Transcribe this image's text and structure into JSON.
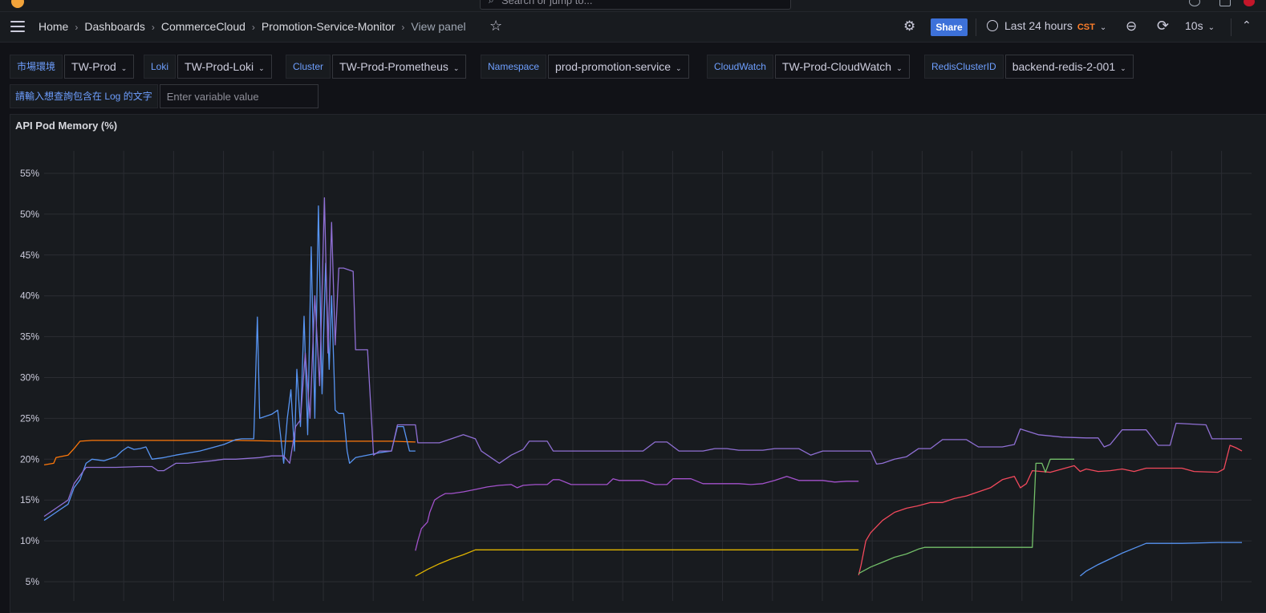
{
  "search": {
    "placeholder": "Search or jump to..."
  },
  "breadcrumbs": [
    "Home",
    "Dashboards",
    "CommerceCloud",
    "Promotion-Service-Monitor",
    "View panel"
  ],
  "toolbar": {
    "share_label": "Share",
    "time_range": "Last 24 hours",
    "timezone": "CST",
    "refresh_interval": "10s"
  },
  "variables": [
    {
      "label": "市場環境",
      "value": "TW-Prod"
    },
    {
      "label": "Loki",
      "value": "TW-Prod-Loki"
    },
    {
      "label": "Cluster",
      "value": "TW-Prod-Prometheus"
    },
    {
      "label": "Namespace",
      "value": "prod-promotion-service"
    },
    {
      "label": "CloudWatch",
      "value": "TW-Prod-CloudWatch"
    },
    {
      "label": "RedisClusterID",
      "value": "backend-redis-2-001"
    }
  ],
  "text_variable": {
    "label": "請輸入想查詢包含在 Log 的文字",
    "placeholder": "Enter variable value"
  },
  "panel": {
    "title": "API Pod Memory (%)"
  },
  "chart_data": {
    "type": "line",
    "title": "API Pod Memory (%)",
    "ylim": [
      3,
      57
    ],
    "yticks": [
      "5%",
      "10%",
      "15%",
      "20%",
      "25%",
      "30%",
      "35%",
      "40%",
      "45%",
      "50%",
      "55%"
    ],
    "ytick_values": [
      5,
      10,
      15,
      20,
      25,
      30,
      35,
      40,
      45,
      50,
      55
    ],
    "xlim": [
      0,
      100
    ],
    "grid": true,
    "series": [
      {
        "color": "#ff780a",
        "points": [
          [
            0,
            19.3
          ],
          [
            0.8,
            19.5
          ],
          [
            1,
            20.2
          ],
          [
            2,
            20.5
          ],
          [
            2.5,
            21.3
          ],
          [
            3,
            22.2
          ],
          [
            4,
            22.3
          ],
          [
            10,
            22.3
          ],
          [
            16,
            22.3
          ],
          [
            20,
            22.2
          ],
          [
            29,
            22.2
          ],
          [
            31,
            22.1
          ]
        ]
      },
      {
        "color": "#5794f2",
        "points": [
          [
            0,
            12.5
          ],
          [
            1,
            13.5
          ],
          [
            2,
            14.5
          ],
          [
            2.5,
            16.5
          ],
          [
            3,
            17.5
          ],
          [
            3.5,
            19.5
          ],
          [
            4,
            20
          ],
          [
            5,
            19.8
          ],
          [
            6,
            20.3
          ],
          [
            6.5,
            21
          ],
          [
            7,
            21.5
          ],
          [
            7.5,
            21.2
          ],
          [
            8,
            21.3
          ],
          [
            8.5,
            21.5
          ],
          [
            9,
            20
          ],
          [
            10,
            20.2
          ],
          [
            11,
            20.5
          ],
          [
            13,
            21
          ],
          [
            15,
            21.8
          ],
          [
            16,
            22.4
          ],
          [
            16.5,
            22.5
          ],
          [
            17.5,
            22.5
          ],
          [
            17.8,
            37.4
          ],
          [
            18,
            25
          ],
          [
            19,
            25.5
          ],
          [
            19.5,
            26
          ],
          [
            20,
            19.5
          ],
          [
            20.3,
            25
          ],
          [
            20.6,
            28.5
          ],
          [
            20.9,
            21
          ],
          [
            21.1,
            31
          ],
          [
            21.4,
            24
          ],
          [
            21.7,
            37.5
          ],
          [
            22,
            23
          ],
          [
            22.3,
            46
          ],
          [
            22.6,
            25
          ],
          [
            22.9,
            51
          ],
          [
            23.2,
            28
          ],
          [
            23.5,
            44
          ],
          [
            23.8,
            31
          ],
          [
            24,
            40
          ],
          [
            24.3,
            26
          ],
          [
            24.6,
            25.6
          ],
          [
            25,
            25.6
          ],
          [
            25.3,
            21
          ],
          [
            25.5,
            19.5
          ],
          [
            26,
            20.2
          ],
          [
            27,
            20.5
          ],
          [
            28,
            20.8
          ],
          [
            29,
            21
          ],
          [
            29.5,
            24
          ],
          [
            30,
            24
          ],
          [
            30.5,
            21
          ],
          [
            31,
            21
          ]
        ]
      },
      {
        "color": "#8f6fd4",
        "points": [
          [
            0,
            13
          ],
          [
            1,
            14
          ],
          [
            2,
            15
          ],
          [
            2.5,
            17
          ],
          [
            3,
            18
          ],
          [
            3.5,
            19
          ],
          [
            4,
            19
          ],
          [
            6,
            19
          ],
          [
            8,
            19.1
          ],
          [
            9,
            19.1
          ],
          [
            9.5,
            18.6
          ],
          [
            10,
            18.6
          ],
          [
            11,
            19.5
          ],
          [
            12,
            19.5
          ],
          [
            14,
            19.8
          ],
          [
            15,
            20
          ],
          [
            16,
            20
          ],
          [
            17,
            20.1
          ],
          [
            18,
            20.2
          ],
          [
            19,
            20.4
          ],
          [
            20,
            20.4
          ],
          [
            20.5,
            19.5
          ],
          [
            21,
            24
          ],
          [
            21.4,
            24.8
          ],
          [
            21.8,
            33
          ],
          [
            22.2,
            25
          ],
          [
            22.6,
            40
          ],
          [
            23,
            29
          ],
          [
            23.4,
            52
          ],
          [
            23.7,
            33
          ],
          [
            24,
            49
          ],
          [
            24.3,
            34
          ],
          [
            24.6,
            43.4
          ],
          [
            25,
            43.4
          ],
          [
            25.8,
            43
          ],
          [
            26,
            33.4
          ],
          [
            27,
            33.4
          ],
          [
            27.5,
            20.5
          ],
          [
            28,
            21
          ],
          [
            29,
            21
          ],
          [
            29.5,
            24.2
          ],
          [
            31,
            24.2
          ],
          [
            31.2,
            22
          ],
          [
            33,
            22
          ],
          [
            34,
            22.5
          ],
          [
            35,
            23
          ],
          [
            36,
            22.5
          ],
          [
            36.5,
            21
          ],
          [
            37,
            20.5
          ],
          [
            38,
            19.5
          ],
          [
            39,
            20.5
          ],
          [
            40,
            21.2
          ],
          [
            40.5,
            22.2
          ],
          [
            42,
            22.2
          ],
          [
            42.5,
            21
          ],
          [
            45,
            21
          ],
          [
            50,
            21
          ],
          [
            51,
            22.1
          ],
          [
            52,
            22.1
          ],
          [
            53,
            21
          ],
          [
            55,
            21
          ],
          [
            56,
            21.3
          ],
          [
            57,
            21.3
          ],
          [
            58,
            21.1
          ],
          [
            60,
            21.1
          ],
          [
            61,
            21.3
          ],
          [
            63,
            21.3
          ],
          [
            64,
            20.5
          ],
          [
            65,
            21
          ],
          [
            66,
            21
          ],
          [
            68,
            21
          ],
          [
            69,
            21
          ],
          [
            69.5,
            19.4
          ],
          [
            70,
            19.5
          ],
          [
            71,
            20
          ],
          [
            72,
            20.3
          ],
          [
            73,
            21.3
          ],
          [
            74,
            21.3
          ],
          [
            75,
            22.4
          ],
          [
            77,
            22.4
          ],
          [
            78,
            21.5
          ],
          [
            79,
            21.5
          ],
          [
            80,
            21.5
          ],
          [
            81,
            21.8
          ],
          [
            81.5,
            23.7
          ],
          [
            83,
            23
          ],
          [
            85,
            22.7
          ],
          [
            87,
            22.6
          ],
          [
            88,
            22.6
          ],
          [
            88.5,
            21.5
          ],
          [
            89,
            21.8
          ],
          [
            90,
            23.6
          ],
          [
            92,
            23.6
          ],
          [
            93,
            21.7
          ],
          [
            94,
            21.7
          ],
          [
            94.5,
            24.4
          ],
          [
            97,
            24.2
          ],
          [
            97.5,
            22.5
          ],
          [
            100,
            22.5
          ]
        ]
      },
      {
        "color": "#a352cc",
        "points": [
          [
            31,
            8.8
          ],
          [
            31.2,
            10
          ],
          [
            31.5,
            11.5
          ],
          [
            32,
            12.3
          ],
          [
            32.2,
            13.5
          ],
          [
            32.6,
            15
          ],
          [
            33,
            15.4
          ],
          [
            33.5,
            15.8
          ],
          [
            34,
            15.8
          ],
          [
            35,
            16
          ],
          [
            36,
            16.3
          ],
          [
            37,
            16.6
          ],
          [
            38,
            16.8
          ],
          [
            39,
            16.9
          ],
          [
            39.5,
            16.5
          ],
          [
            40,
            16.8
          ],
          [
            41,
            16.9
          ],
          [
            42,
            16.9
          ],
          [
            42.5,
            17.5
          ],
          [
            43,
            17.5
          ],
          [
            44,
            16.9
          ],
          [
            47,
            16.9
          ],
          [
            47.5,
            17.6
          ],
          [
            48,
            17.4
          ],
          [
            50,
            17.4
          ],
          [
            51,
            16.9
          ],
          [
            52,
            16.9
          ],
          [
            52.5,
            17.6
          ],
          [
            54,
            17.6
          ],
          [
            55,
            17
          ],
          [
            57,
            17
          ],
          [
            58,
            17
          ],
          [
            59,
            16.9
          ],
          [
            60,
            17
          ],
          [
            61,
            17.4
          ],
          [
            62,
            17.9
          ],
          [
            63,
            17.4
          ],
          [
            65,
            17.4
          ],
          [
            66,
            17.2
          ],
          [
            67,
            17.3
          ],
          [
            68,
            17.3
          ]
        ]
      },
      {
        "color": "#e0b400",
        "points": [
          [
            31,
            5.7
          ],
          [
            32,
            6.5
          ],
          [
            33,
            7.2
          ],
          [
            34,
            7.8
          ],
          [
            35,
            8.3
          ],
          [
            36,
            8.9
          ],
          [
            40,
            8.9
          ],
          [
            50,
            8.9
          ],
          [
            60,
            8.9
          ],
          [
            65,
            8.9
          ],
          [
            68,
            8.9
          ]
        ]
      },
      {
        "color": "#f2495c",
        "points": [
          [
            68,
            5.8
          ],
          [
            68.2,
            7
          ],
          [
            68.4,
            8.5
          ],
          [
            68.6,
            10
          ],
          [
            69,
            11
          ],
          [
            70,
            12.5
          ],
          [
            71,
            13.5
          ],
          [
            72,
            14
          ],
          [
            73,
            14.3
          ],
          [
            74,
            14.7
          ],
          [
            75,
            14.7
          ],
          [
            76,
            15.2
          ],
          [
            77,
            15.5
          ],
          [
            78,
            16
          ],
          [
            79,
            16.5
          ],
          [
            80,
            17.5
          ],
          [
            81,
            17.9
          ],
          [
            81.5,
            16.5
          ],
          [
            82,
            17
          ],
          [
            82.5,
            18.6
          ],
          [
            84,
            18.4
          ],
          [
            85,
            18.8
          ],
          [
            86,
            19.2
          ],
          [
            86.5,
            18.5
          ],
          [
            87,
            18.8
          ],
          [
            88,
            18.5
          ],
          [
            89,
            18.6
          ],
          [
            90,
            18.8
          ],
          [
            91,
            18.5
          ],
          [
            92,
            18.9
          ],
          [
            95,
            18.9
          ],
          [
            96,
            18.5
          ],
          [
            98,
            18.4
          ],
          [
            98.5,
            18.8
          ],
          [
            99,
            21.7
          ],
          [
            99.5,
            21.4
          ],
          [
            100,
            21
          ]
        ]
      },
      {
        "color": "#73bf69",
        "points": [
          [
            68,
            6
          ],
          [
            69,
            6.8
          ],
          [
            70,
            7.4
          ],
          [
            71,
            8
          ],
          [
            72,
            8.4
          ],
          [
            73,
            9
          ],
          [
            73.5,
            9.2
          ],
          [
            76,
            9.2
          ],
          [
            79,
            9.2
          ],
          [
            82,
            9.2
          ],
          [
            82.5,
            9.2
          ],
          [
            82.8,
            19.5
          ],
          [
            83.3,
            19.5
          ],
          [
            83.6,
            18.4
          ],
          [
            84,
            20
          ],
          [
            86,
            20
          ]
        ]
      },
      {
        "color": "#5794f2",
        "points": [
          [
            86.5,
            5.7
          ],
          [
            87,
            6.3
          ],
          [
            88,
            7.1
          ],
          [
            89,
            7.8
          ],
          [
            90,
            8.5
          ],
          [
            91,
            9.1
          ],
          [
            92,
            9.7
          ],
          [
            95,
            9.7
          ],
          [
            98,
            9.8
          ],
          [
            100,
            9.8
          ]
        ]
      }
    ]
  }
}
